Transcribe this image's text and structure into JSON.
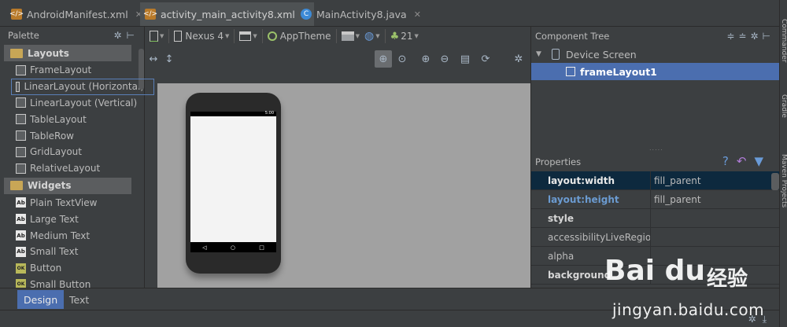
{
  "tabs": [
    {
      "label": "AndroidManifest.xml",
      "icon": "xml-file-icon"
    },
    {
      "label": "activity_main_activity8.xml",
      "icon": "xml-file-icon"
    },
    {
      "label": "MainActivity8.java",
      "icon": "java-class-icon"
    }
  ],
  "palette": {
    "title": "Palette",
    "layouts_label": "Layouts",
    "layouts": [
      "FrameLayout",
      "LinearLayout (Horizontal)",
      "LinearLayout (Vertical)",
      "TableLayout",
      "TableRow",
      "GridLayout",
      "RelativeLayout"
    ],
    "widgets_label": "Widgets",
    "widgets": [
      "Plain TextView",
      "Large Text",
      "Medium Text",
      "Small Text",
      "Button",
      "Small Button"
    ],
    "widget_icon_ab": "Ab",
    "widget_icon_ok": "OK"
  },
  "toolbar": {
    "device": "Nexus 4",
    "theme": "AppTheme",
    "api": "21"
  },
  "phone": {
    "status_time": "5:00"
  },
  "component_tree": {
    "title": "Component Tree",
    "root": "Device Screen",
    "child": "frameLayout1"
  },
  "properties": {
    "title": "Properties",
    "rows": [
      {
        "name": "layout:width",
        "value": "fill_parent"
      },
      {
        "name": "layout:height",
        "value": "fill_parent"
      },
      {
        "name": "style",
        "value": ""
      },
      {
        "name": "accessibilityLiveRegion",
        "value": ""
      },
      {
        "name": "alpha",
        "value": ""
      },
      {
        "name": "background",
        "value": ""
      }
    ]
  },
  "right_stripe": [
    "Commander",
    "Gradle",
    "Maven Projects"
  ],
  "bottom_tabs": {
    "design": "Design",
    "text": "Text"
  },
  "watermark": {
    "logo": "Bai du",
    "cn": "经验",
    "url": "jingyan.baidu.com"
  },
  "colors": {
    "selection": "#4b6eaf",
    "prop_selection": "#0d293e",
    "canvas": "#a1a1a1"
  }
}
